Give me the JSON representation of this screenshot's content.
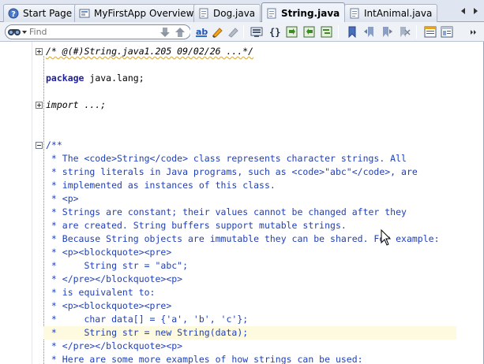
{
  "tabs": [
    {
      "label": "Start Page",
      "icon": "help-icon",
      "active": false
    },
    {
      "label": "MyFirstApp Overview",
      "icon": "overview-icon",
      "active": false
    },
    {
      "label": "Dog.java",
      "icon": "java-file-icon",
      "active": false
    },
    {
      "label": "String.java",
      "icon": "java-file-icon",
      "active": true
    },
    {
      "label": "IntAnimal.java",
      "icon": "java-file-icon",
      "active": false
    }
  ],
  "toolbar": {
    "search_placeholder": "Find"
  },
  "editor": {
    "lines": {
      "l1": "/* @(#)String.java1.205 09/02/26 ...*/",
      "l3_kw": "package",
      "l3_rest": " java.lang;",
      "l5": "import ...;",
      "l8": "/**",
      "l9": " * The <code>String</code> class represents character strings. All",
      "l10": " * string literals in Java programs, such as <code>\"abc\"</code>, are",
      "l11": " * implemented as instances of this class.",
      "l12": " * <p>",
      "l13": " * Strings are constant; their values cannot be changed after they",
      "l14": " * are created. String buffers support mutable strings.",
      "l15": " * Because String objects are immutable they can be shared. For example:",
      "l16": " * <p><blockquote><pre>",
      "l17": " *     String str = \"abc\";",
      "l18": " * </pre></blockquote><p>",
      "l19": " * is equivalent to:",
      "l20": " * <p><blockquote><pre>",
      "l21": " *     char data[] = {'a', 'b', 'c'};",
      "l22": " *     String str = new String(data);",
      "l23": " * </pre></blockquote><p>",
      "l24": " * Here are some more examples of how strings can be used:"
    }
  },
  "colors": {
    "javadoc": "#1f3fb8",
    "keyword": "#1e1e9e",
    "current_line": "#fdfadf",
    "tab_bar": "#dfe6f1"
  }
}
